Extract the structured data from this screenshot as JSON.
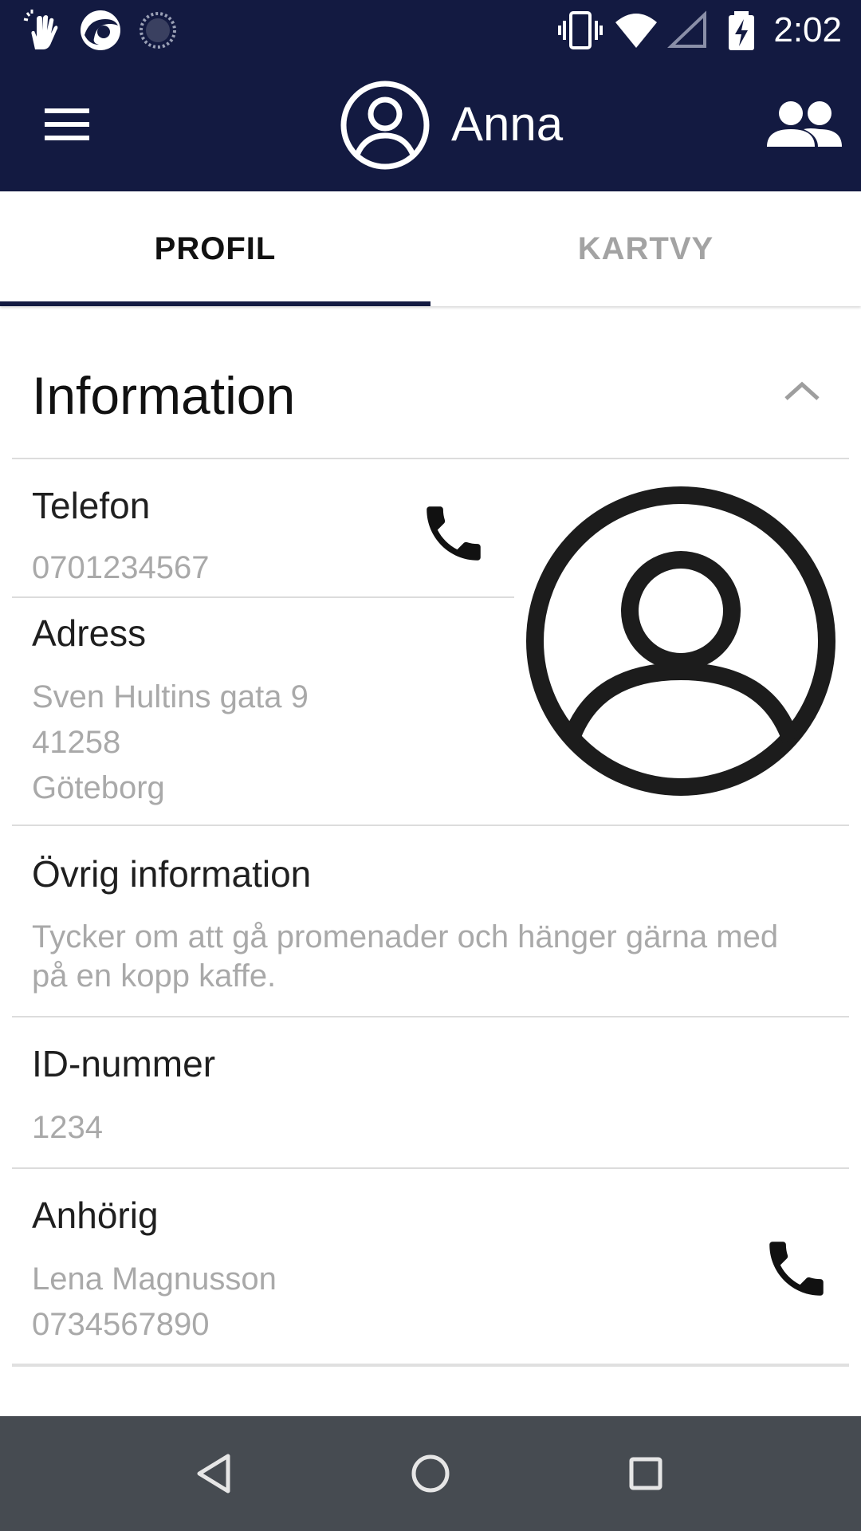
{
  "status_bar": {
    "time": "2:02",
    "left_icons": [
      "hand-gesture-icon",
      "app-logo-icon",
      "sync-icon"
    ],
    "right_icons": [
      "vibrate-icon",
      "wifi-icon",
      "signal-icon",
      "battery-charging-icon"
    ]
  },
  "app_bar": {
    "title": "Anna",
    "menu_icon": "hamburger-menu-icon",
    "avatar_icon": "account-circle-icon",
    "action_icon": "group-icon",
    "background": "#131a41"
  },
  "tabs": [
    {
      "label": "PROFIL",
      "active": true
    },
    {
      "label": "KARTVY",
      "active": false
    }
  ],
  "section": {
    "title": "Information",
    "expanded": true,
    "fields": {
      "telefon": {
        "label": "Telefon",
        "value": "0701234567"
      },
      "adress": {
        "label": "Adress",
        "lines": [
          "Sven Hultins gata 9",
          "41258",
          "Göteborg"
        ]
      },
      "ovrig": {
        "label": "Övrig information",
        "lines": [
          "Tycker om att gå promenader och hänger gärna med",
          "på en kopp kaffe."
        ]
      },
      "id": {
        "label": "ID-nummer",
        "value": "1234"
      },
      "anhorig": {
        "label": "Anhörig",
        "lines": [
          "Lena Magnusson",
          "0734567890"
        ]
      }
    }
  },
  "colors": {
    "primary": "#131a41",
    "text": "#1f1f1f",
    "secondary_text": "#a9a9a9",
    "inactive_tab": "#a3a3a3",
    "nav_bar": "#464b51"
  },
  "nav_bar": [
    "back-icon",
    "home-icon",
    "recents-icon"
  ]
}
